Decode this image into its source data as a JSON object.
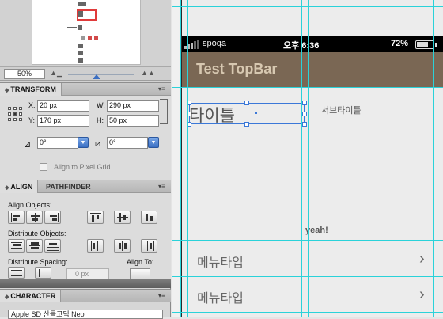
{
  "navigator": {
    "zoom_value": "50%"
  },
  "transform": {
    "tab_label": "TRANSFORM",
    "x_label": "X:",
    "x_value": "20 px",
    "y_label": "Y:",
    "y_value": "170 px",
    "w_label": "W:",
    "w_value": "290 px",
    "h_label": "H:",
    "h_value": "50 px",
    "rotate_value": "0°",
    "shear_value": "0°",
    "pixel_grid_label": "Align to Pixel Grid"
  },
  "align": {
    "tab_align": "ALIGN",
    "tab_pathfinder": "PATHFINDER",
    "align_objects_label": "Align Objects:",
    "distribute_objects_label": "Distribute Objects:",
    "distribute_spacing_label": "Distribute Spacing:",
    "spacing_value": "0 px",
    "align_to_label": "Align To:"
  },
  "character": {
    "tab_label": "CHARACTER",
    "font_value": "Apple SD 산돌고딕 Neo"
  },
  "phone": {
    "carrier": "spoqa",
    "time": "오후 6:36",
    "battery_text": "72%",
    "battery_level": 0.72,
    "topbar_title": "Test TopBar",
    "title": "타이틀",
    "subtitle": "서브타이틀",
    "yeah_text": "yeah!",
    "menu_items": [
      {
        "label": "메뉴타입",
        "chevron": "›"
      },
      {
        "label": "메뉴타입",
        "chevron": "›"
      }
    ]
  },
  "colors": {
    "topbar_bg": "#7a6754",
    "topbar_text": "#d7c8b1",
    "guide": "#2ad2d9",
    "selection": "#3b78d8"
  }
}
